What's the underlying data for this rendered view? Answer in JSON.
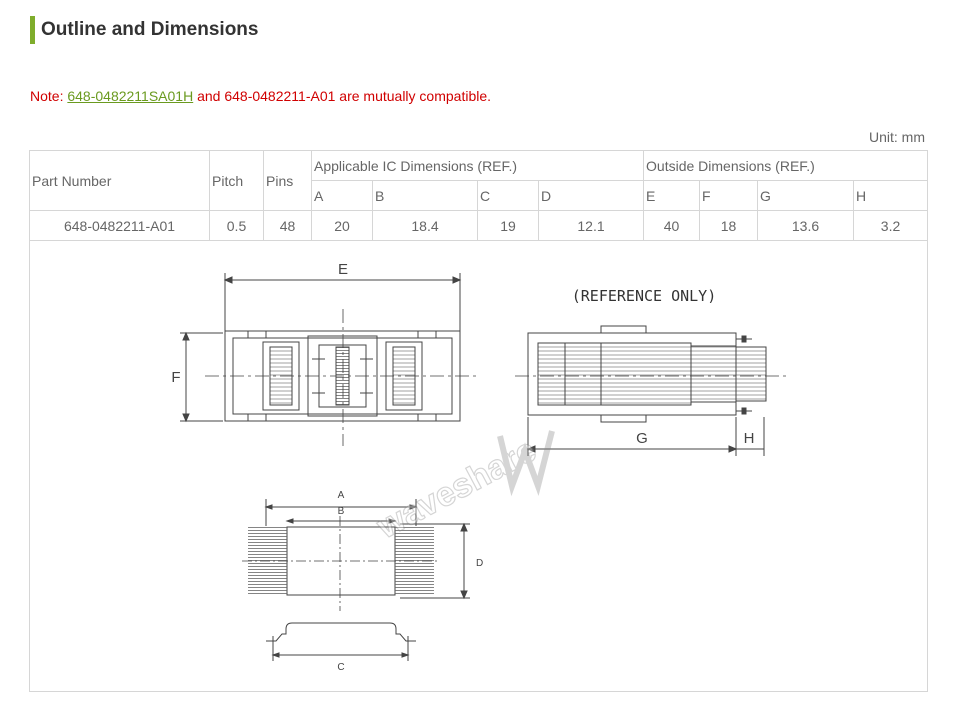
{
  "section": {
    "title": "Outline and Dimensions"
  },
  "note": {
    "prefix": "Note: ",
    "link_text": "648-0482211SA01H",
    "suffix": " and 648-0482211-A01 are mutually compatible."
  },
  "unit_label": "Unit: mm",
  "table": {
    "headers": {
      "part_number": "Part Number",
      "pitch": "Pitch",
      "pins": "Pins",
      "ic_group": "Applicable IC Dimensions (REF.)",
      "outside_group": "Outside Dimensions (REF.)",
      "ic_cols": [
        "A",
        "B",
        "C",
        "D"
      ],
      "outside_cols": [
        "E",
        "F",
        "G",
        "H"
      ]
    },
    "row": {
      "part_number": "648-0482211-A01",
      "pitch": "0.5",
      "pins": "48",
      "ic": [
        "20",
        "18.4",
        "19",
        "12.1"
      ],
      "outside": [
        "40",
        "18",
        "13.6",
        "3.2"
      ]
    }
  },
  "drawing": {
    "reference_note": "(REFERENCE ONLY)",
    "watermark": "waveshare",
    "labels": {
      "E": "E",
      "F": "F",
      "G": "G",
      "H": "H",
      "A": "A",
      "B": "B",
      "C": "C",
      "D": "D"
    }
  },
  "colors": {
    "accent": "#7fad2c",
    "note_red": "#d00000",
    "link_green": "#6a9a1f",
    "border": "#d6d6d6"
  }
}
